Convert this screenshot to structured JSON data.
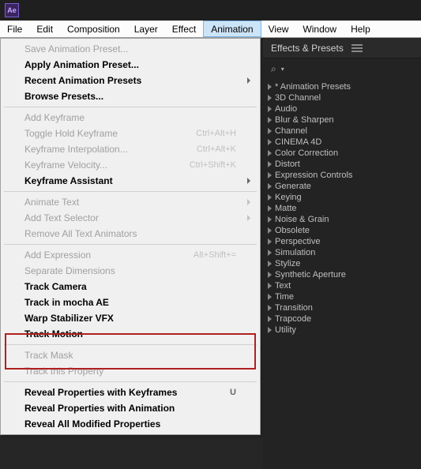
{
  "app": {
    "logo_text": "Ae"
  },
  "menubar": {
    "items": [
      "File",
      "Edit",
      "Composition",
      "Layer",
      "Effect",
      "Animation",
      "View",
      "Window",
      "Help"
    ],
    "active_index": 5
  },
  "dropdown": [
    {
      "label": "Save Animation Preset...",
      "disabled": true
    },
    {
      "label": "Apply Animation Preset...",
      "bold": true
    },
    {
      "label": "Recent Animation Presets",
      "bold": true,
      "submenu": true
    },
    {
      "label": "Browse Presets...",
      "bold": true
    },
    {
      "sep": true
    },
    {
      "label": "Add Keyframe",
      "disabled": true
    },
    {
      "label": "Toggle Hold Keyframe",
      "disabled": true,
      "shortcut": "Ctrl+Alt+H"
    },
    {
      "label": "Keyframe Interpolation...",
      "disabled": true,
      "shortcut": "Ctrl+Alt+K"
    },
    {
      "label": "Keyframe Velocity...",
      "disabled": true,
      "shortcut": "Ctrl+Shift+K"
    },
    {
      "label": "Keyframe Assistant",
      "bold": true,
      "submenu": true
    },
    {
      "sep": true
    },
    {
      "label": "Animate Text",
      "disabled": true,
      "submenu": true
    },
    {
      "label": "Add Text Selector",
      "disabled": true,
      "submenu": true
    },
    {
      "label": "Remove All Text Animators",
      "disabled": true
    },
    {
      "sep": true
    },
    {
      "label": "Add Expression",
      "disabled": true,
      "shortcut": "Alt+Shift+="
    },
    {
      "label": "Separate Dimensions",
      "disabled": true
    },
    {
      "label": "Track Camera",
      "bold": true
    },
    {
      "label": "Track in mocha AE",
      "bold": true
    },
    {
      "label": "Warp Stabilizer VFX",
      "bold": true
    },
    {
      "label": "Track Motion",
      "bold": true
    },
    {
      "sep": true
    },
    {
      "label": "Track Mask",
      "disabled": true
    },
    {
      "label": "Track this Property",
      "disabled": true
    },
    {
      "sep": true
    },
    {
      "label": "Reveal Properties with Keyframes",
      "bold": true,
      "shortcut": "U"
    },
    {
      "label": "Reveal Properties with Animation",
      "bold": true
    },
    {
      "label": "Reveal All Modified Properties",
      "bold": true
    }
  ],
  "panel": {
    "title": "Effects & Presets",
    "search_icon": "⌕",
    "tree": [
      "* Animation Presets",
      "3D Channel",
      "Audio",
      "Blur & Sharpen",
      "Channel",
      "CINEMA 4D",
      "Color Correction",
      "Distort",
      "Expression Controls",
      "Generate",
      "Keying",
      "Matte",
      "Noise & Grain",
      "Obsolete",
      "Perspective",
      "Simulation",
      "Stylize",
      "Synthetic Aperture",
      "Text",
      "Time",
      "Transition",
      "Trapcode",
      "Utility"
    ]
  }
}
